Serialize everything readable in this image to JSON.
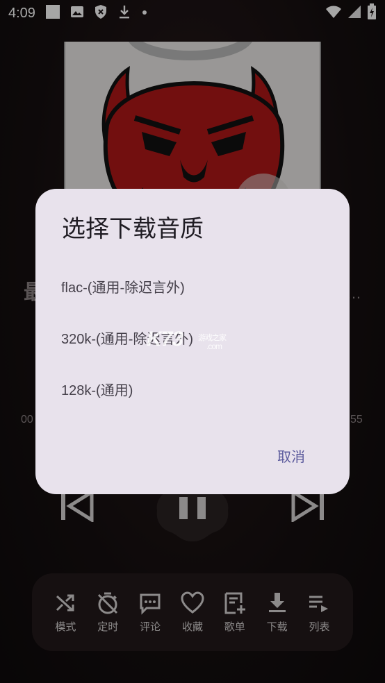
{
  "status": {
    "time": "4:09"
  },
  "player": {
    "title_left": "最",
    "title_right": "…",
    "time_elapsed": "00",
    "time_total": "55"
  },
  "toolbar": {
    "items": [
      {
        "label": "模式",
        "icon": "shuffle-icon"
      },
      {
        "label": "定时",
        "icon": "timer-off-icon"
      },
      {
        "label": "评论",
        "icon": "comment-icon"
      },
      {
        "label": "收藏",
        "icon": "heart-icon"
      },
      {
        "label": "歌单",
        "icon": "playlist-add-icon"
      },
      {
        "label": "下载",
        "icon": "download-icon"
      },
      {
        "label": "列表",
        "icon": "queue-icon"
      }
    ]
  },
  "dialog": {
    "title": "选择下载音质",
    "options": [
      "flac-(通用-除迟言外)",
      "320k-(通用-除迟言外)",
      "128k-(通用)"
    ],
    "cancel": "取消"
  },
  "watermark": {
    "brand": "K73",
    "sub": "游戏之家",
    "com": ".com"
  },
  "colors": {
    "dialog_bg": "#e8e2ec",
    "accent": "#5b5a9c",
    "toolbar_bg": "#221a1b"
  }
}
